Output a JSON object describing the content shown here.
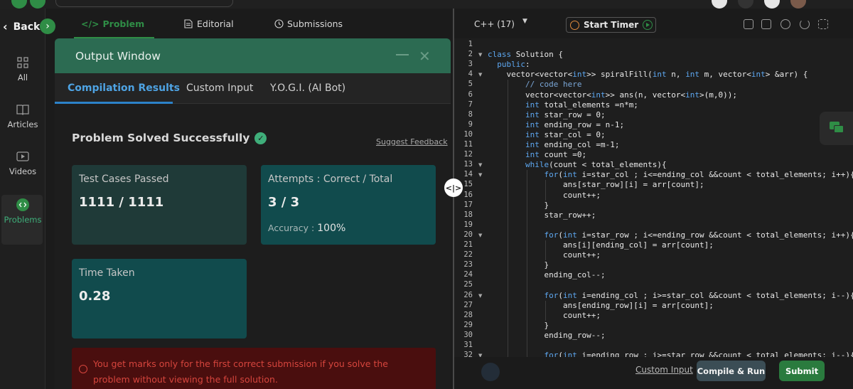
{
  "sidebar": {
    "back_label": "Back",
    "items": [
      {
        "label": "All",
        "icon": "grid-icon"
      },
      {
        "label": "Articles",
        "icon": "book-icon"
      },
      {
        "label": "Videos",
        "icon": "video-icon"
      },
      {
        "label": "Problems",
        "icon": "code-icon"
      }
    ],
    "active": "Problems"
  },
  "problem_tabs": [
    {
      "label": "Problem",
      "icon": "code-icon",
      "active": true
    },
    {
      "label": "Editorial",
      "icon": "document-icon"
    },
    {
      "label": "Submissions",
      "icon": "clock-icon"
    }
  ],
  "output_window": {
    "title": "Output Window",
    "tabs": [
      "Compilation Results",
      "Custom Input",
      "Y.O.G.I. (AI Bot)"
    ],
    "active_tab": "Compilation Results",
    "status": "Problem Solved Successfully",
    "suggest_feedback": "Suggest Feedback",
    "test_cases_label": "Test Cases Passed",
    "test_cases_value": "1111 / 1111",
    "attempts_label": "Attempts : Correct / Total",
    "attempts_value": "3 / 3",
    "accuracy_label": "Accuracy :",
    "accuracy_value": "100%",
    "time_label": "Time Taken",
    "time_value": "0.28",
    "warning": "You get marks only for the first correct submission if you solve the problem without viewing the full solution."
  },
  "editor": {
    "language": "C++ (17)",
    "timer_label": "Start Timer",
    "custom_input": "Custom Input",
    "compile_run": "Compile & Run",
    "submit": "Submit",
    "code_lines": [
      "",
      "class Solution {",
      "  public:",
      "    vector<vector<int>> spiralFill(int n, int m, vector<int> &arr) {",
      "        // code here",
      "        vector<vector<int>> ans(n, vector<int>(m,0));",
      "        int total_elements =n*m;",
      "        int star_row = 0;",
      "        int ending_row = n-1;",
      "        int star_col = 0;",
      "        int ending_col =m-1;",
      "        int count =0;",
      "        while(count < total_elements){",
      "            for(int i=star_col ; i<=ending_col &&count < total_elements; i++){",
      "                ans[star_row][i] = arr[count];",
      "                count++;",
      "            }",
      "            star_row++;",
      "",
      "            for(int i=star_row ; i<=ending_row &&count < total_elements; i++){",
      "                ans[i][ending_col] = arr[count];",
      "                count++;",
      "            }",
      "            ending_col--;",
      "",
      "            for(int i=ending_col ; i>=star_col &&count < total_elements; i--){",
      "                ans[ending_row][i] = arr[count];",
      "                count++;",
      "            }",
      "            ending_row--;",
      "",
      "            for(int i=ending_row ; i>=star_row &&count < total_elements; i--){"
    ],
    "fold_lines": [
      2,
      4,
      13,
      14,
      20,
      26,
      32
    ]
  },
  "colors": {
    "accent": "#2f8d46",
    "tab_active": "#4ea3e3",
    "warning": "#d6453d"
  }
}
